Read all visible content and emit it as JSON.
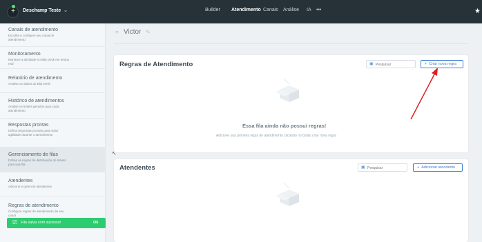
{
  "header": {
    "account_name": "Deschamp Teste",
    "account_chevron": "⌄",
    "nav": [
      {
        "label": "Builder",
        "active": false
      },
      {
        "label": "Atendimento",
        "active": true
      },
      {
        "label": "Canais",
        "active": false
      },
      {
        "label": "Análise",
        "active": false
      },
      {
        "label": "IA",
        "active": false
      },
      {
        "label": "•••",
        "active": false
      }
    ]
  },
  "sidebar": {
    "items": [
      {
        "title": "Canais de atendimento",
        "desc": "Escolha e configure seu canal de atendimento"
      },
      {
        "title": "Monitoramento",
        "desc": "Monitore a atividade no Blip Desk em tempo real"
      },
      {
        "title": "Relatório de atendimento",
        "desc": "Analise os dados do Blip Desk"
      },
      {
        "title": "Histórico de atendimentos",
        "desc": "Analise os tickets gerados para cada atendimento"
      },
      {
        "title": "Respostas prontas",
        "desc": "Defina respostas prontas para maior agilidade durante o atendimento"
      },
      {
        "title": "Gerenciamento de filas",
        "desc": "Defina as regras de distribuição de tickets para sua fila"
      },
      {
        "title": "Atendentes",
        "desc": "Adicione e gerencie atendentes"
      },
      {
        "title": "Regras de atendimento",
        "desc": "Configure regras de atendimento de seu canal"
      }
    ],
    "toast": {
      "text": "Fila salva com sucesso!",
      "ok": "Ok"
    }
  },
  "queue": {
    "name": "Victor"
  },
  "rules_card": {
    "title": "Regras de Atendimento",
    "search_placeholder": "Pesquisar",
    "button_label": "Criar nova regra",
    "empty_title": "Essa fila ainda não possui regras!",
    "empty_desc": "Adicione sua primeira regra de atendimento clicando no botão criar nova regra"
  },
  "agents_card": {
    "title": "Atendentes",
    "search_placeholder": "Pesquisar",
    "button_label": "Adicionar atendente"
  },
  "colors": {
    "topbar": "#263238",
    "accent": "#3d7fd0",
    "toast": "#2ecc71",
    "annotation": "#e02020"
  }
}
